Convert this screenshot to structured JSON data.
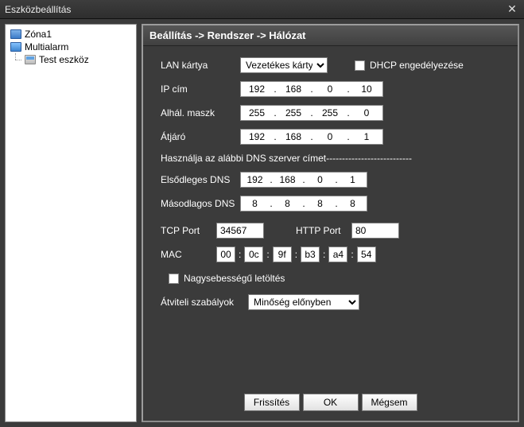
{
  "window": {
    "title": "Eszközbeállítás"
  },
  "tree": {
    "items": [
      {
        "label": "Zóna1"
      },
      {
        "label": "Multialarm"
      },
      {
        "label": "Test eszköz"
      }
    ]
  },
  "breadcrumb": "Beállítás -> Rendszer -> Hálózat",
  "labels": {
    "lan": "LAN kártya",
    "dhcp": "DHCP engedélyezése",
    "ip": "IP cím",
    "subnet": "Alhál. maszk",
    "gateway": "Átjáró",
    "dns_section": "Használja az alábbi DNS szerver címet",
    "dns_dashes": "---------------------------",
    "dns1": "Elsődleges DNS",
    "dns2": "Másodlagos DNS",
    "tcp": "TCP Port",
    "http": "HTTP Port",
    "mac": "MAC",
    "highspeed": "Nagysebességű letöltés",
    "transfer": "Átviteli szabályok"
  },
  "values": {
    "lan_card": "Vezetékes kárty",
    "ip": [
      "192",
      "168",
      "0",
      "10"
    ],
    "subnet": [
      "255",
      "255",
      "255",
      "0"
    ],
    "gateway": [
      "192",
      "168",
      "0",
      "1"
    ],
    "dns1": [
      "192",
      "168",
      "0",
      "1"
    ],
    "dns2": [
      "8",
      "8",
      "8",
      "8"
    ],
    "tcp": "34567",
    "http": "80",
    "mac": [
      "00",
      "0c",
      "9f",
      "b3",
      "a4",
      "54"
    ],
    "transfer": "Minőség előnyben"
  },
  "buttons": {
    "refresh": "Frissítés",
    "ok": "OK",
    "cancel": "Mégsem"
  }
}
